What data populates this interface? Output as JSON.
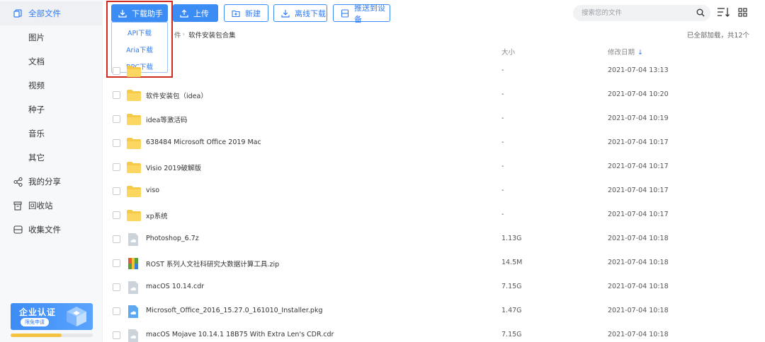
{
  "sidebar": {
    "items": [
      {
        "label": "全部文件",
        "icon": "files-icon"
      },
      {
        "label": "图片"
      },
      {
        "label": "文档"
      },
      {
        "label": "视频"
      },
      {
        "label": "种子"
      },
      {
        "label": "音乐"
      },
      {
        "label": "其它"
      },
      {
        "label": "我的分享",
        "icon": "share-icon"
      },
      {
        "label": "回收站",
        "icon": "trash-icon"
      },
      {
        "label": "收集文件",
        "icon": "collect-icon"
      }
    ],
    "promo": {
      "title": "企业认证",
      "button": "限免申请",
      "progress": 0.62
    }
  },
  "toolbar": {
    "download_helper": "下载助手",
    "upload": "上传",
    "new": "新建",
    "offline_download": "离线下载",
    "push_device": "推送到设备",
    "dropdown": [
      "API下载",
      "Aria下载",
      "RPC下载"
    ]
  },
  "search": {
    "placeholder": "搜索您的文件"
  },
  "breadcrumb": {
    "prev_tail": "件",
    "current": "软件安装包合集"
  },
  "status": {
    "loaded": "已全部加载，共12个"
  },
  "table": {
    "headers": {
      "size": "大小",
      "date": "修改日期"
    },
    "rows": [
      {
        "name": "",
        "size": "-",
        "date": "2021-07-04 13:13",
        "type": "folder"
      },
      {
        "name": "软件安装包（idea）",
        "size": "-",
        "date": "2021-07-04 10:20",
        "type": "folder"
      },
      {
        "name": "idea等激活码",
        "size": "-",
        "date": "2021-07-04 10:19",
        "type": "folder"
      },
      {
        "name": "638484 Microsoft Office 2019 Mac",
        "size": "-",
        "date": "2021-07-04 10:17",
        "type": "folder"
      },
      {
        "name": "Visio 2019破解版",
        "size": "-",
        "date": "2021-07-04 10:17",
        "type": "folder"
      },
      {
        "name": "viso",
        "size": "-",
        "date": "2021-07-04 10:17",
        "type": "folder"
      },
      {
        "name": "xp系统",
        "size": "-",
        "date": "2021-07-04 10:17",
        "type": "folder"
      },
      {
        "name": "Photoshop_6.7z",
        "size": "1.13G",
        "date": "2021-07-04 10:18",
        "type": "file"
      },
      {
        "name": "ROST 系列人文社科研究大数据计算工具.zip",
        "size": "14.5M",
        "date": "2021-07-04 10:18",
        "type": "zip"
      },
      {
        "name": "macOS 10.14.cdr",
        "size": "7.15G",
        "date": "2021-07-04 10:18",
        "type": "file"
      },
      {
        "name": "Microsoft_Office_2016_15.27.0_161010_Installer.pkg",
        "size": "1.47G",
        "date": "2021-07-04 10:18",
        "type": "pkg"
      },
      {
        "name": "macOS Mojave 10.14.1 18B75 With Extra Len's CDR.cdr",
        "size": "7.15G",
        "date": "2021-07-04 10:18",
        "type": "file"
      }
    ]
  },
  "colors": {
    "accent": "#3c8cf6",
    "highlight": "#d32a1f",
    "folder": "#f7c948"
  }
}
